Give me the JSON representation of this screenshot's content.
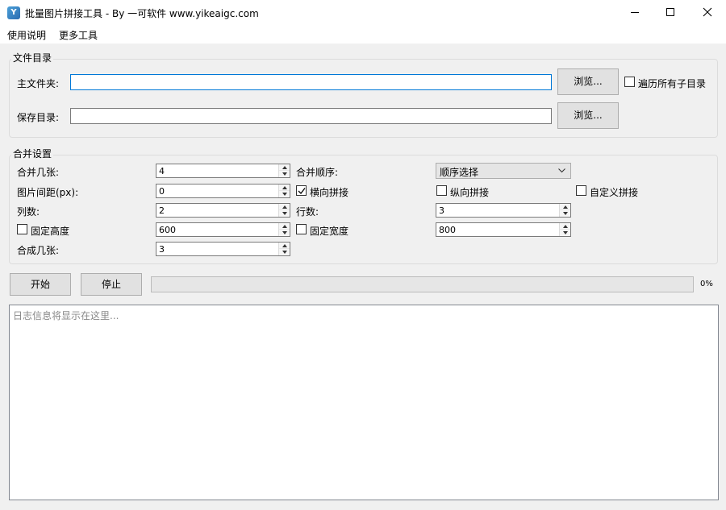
{
  "window": {
    "icon_text": "Y",
    "title": "批量图片拼接工具 - By 一可软件 www.yikeaigc.com"
  },
  "menu": {
    "items": [
      "使用说明",
      "更多工具"
    ]
  },
  "file_group": {
    "title": "文件目录",
    "main_folder_label": "主文件夹:",
    "main_folder_value": "",
    "browse_label": "浏览...",
    "traverse_label": "遍历所有子目录",
    "traverse_checked": false,
    "save_dir_label": "保存目录:",
    "save_dir_value": ""
  },
  "merge_group": {
    "title": "合并设置",
    "merge_count_label": "合并几张:",
    "merge_count_value": "4",
    "merge_order_label": "合并顺序:",
    "merge_order_value": "顺序选择",
    "spacing_label": "图片间距(px):",
    "spacing_value": "0",
    "horizontal_label": "横向拼接",
    "horizontal_checked": true,
    "vertical_label": "纵向拼接",
    "vertical_checked": false,
    "custom_label": "自定义拼接",
    "custom_checked": false,
    "columns_label": "列数:",
    "columns_value": "2",
    "rows_label": "行数:",
    "rows_value": "3",
    "fixed_height_label": "固定高度",
    "fixed_height_checked": false,
    "fixed_height_value": "600",
    "fixed_width_label": "固定宽度",
    "fixed_width_checked": false,
    "fixed_width_value": "800",
    "output_count_label": "合成几张:",
    "output_count_value": "3"
  },
  "actions": {
    "start_label": "开始",
    "stop_label": "停止",
    "progress_value": 0,
    "progress_text": "0%"
  },
  "log": {
    "placeholder": "日志信息将显示在这里..."
  },
  "colors": {
    "accent": "#0078d7",
    "window_bg": "#f0f0f0",
    "progress_fill": "#06b025"
  }
}
